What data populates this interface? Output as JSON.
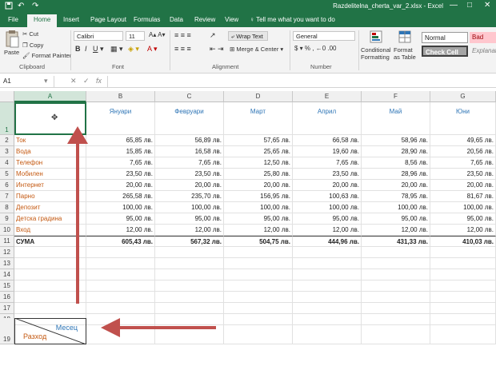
{
  "title_bar": {
    "document_title": "Razdelitelna_cherta_var_2.xlsx - Excel",
    "controls": [
      "—",
      "□",
      "✕"
    ]
  },
  "ribbon_tabs": [
    "File",
    "Home",
    "Insert",
    "Page Layout",
    "Formulas",
    "Data",
    "Review",
    "View"
  ],
  "active_tab": "Home",
  "tell_me": "Tell me what you want to do",
  "ribbon": {
    "clipboard": {
      "paste": "Paste",
      "cut": "Cut",
      "copy": "Copy",
      "format_painter": "Format Painter",
      "label": "Clipboard"
    },
    "font": {
      "name": "Calibri",
      "size": "11",
      "label": "Font"
    },
    "alignment": {
      "wrap_text": "Wrap Text",
      "merge_center": "Merge & Center",
      "label": "Alignment"
    },
    "number": {
      "format": "General",
      "label": "Number"
    },
    "styles": {
      "conditional": "Conditional Formatting",
      "format_table": "Format as Table",
      "normal": "Normal",
      "bad": "Bad",
      "check_cell": "Check Cell",
      "explanatory": "Explanato"
    }
  },
  "formula_bar": {
    "name_box": "A1",
    "fx": "fx",
    "value": ""
  },
  "columns": [
    "A",
    "B",
    "C",
    "D",
    "E",
    "F",
    "G"
  ],
  "header_row": [
    "",
    "Януари",
    "Февруари",
    "Март",
    "Април",
    "Май",
    "Юни"
  ],
  "rows": [
    {
      "n": "2",
      "cells": [
        "Ток",
        "65,85 лв.",
        "56,89 лв.",
        "57,65 лв.",
        "66,58 лв.",
        "58,96 лв.",
        "49,65 лв."
      ]
    },
    {
      "n": "3",
      "cells": [
        "Вода",
        "15,85 лв.",
        "16,58 лв.",
        "25,65 лв.",
        "19,60 лв.",
        "28,90 лв.",
        "20,56 лв."
      ]
    },
    {
      "n": "4",
      "cells": [
        "Телефон",
        "7,65 лв.",
        "7,65 лв.",
        "12,50 лв.",
        "7,65 лв.",
        "8,56 лв.",
        "7,65 лв."
      ]
    },
    {
      "n": "5",
      "cells": [
        "Мобилен",
        "23,50 лв.",
        "23,50 лв.",
        "25,80 лв.",
        "23,50 лв.",
        "28,96 лв.",
        "23,50 лв."
      ]
    },
    {
      "n": "6",
      "cells": [
        "Интернет",
        "20,00 лв.",
        "20,00 лв.",
        "20,00 лв.",
        "20,00 лв.",
        "20,00 лв.",
        "20,00 лв."
      ]
    },
    {
      "n": "7",
      "cells": [
        "Парно",
        "265,58 лв.",
        "235,70 лв.",
        "156,95 лв.",
        "100,63 лв.",
        "78,95 лв.",
        "81,67 лв."
      ]
    },
    {
      "n": "8",
      "cells": [
        "Депозит",
        "100,00 лв.",
        "100,00 лв.",
        "100,00 лв.",
        "100,00 лв.",
        "100,00 лв.",
        "100,00 лв."
      ]
    },
    {
      "n": "9",
      "cells": [
        "Детска градина",
        "95,00 лв.",
        "95,00 лв.",
        "95,00 лв.",
        "95,00 лв.",
        "95,00 лв.",
        "95,00 лв."
      ]
    },
    {
      "n": "10",
      "cells": [
        "Вход",
        "12,00 лв.",
        "12,00 лв.",
        "12,00 лв.",
        "12,00 лв.",
        "12,00 лв.",
        "12,00 лв."
      ]
    },
    {
      "n": "11",
      "cells": [
        "СУМА",
        "605,43 лв.",
        "567,32 лв.",
        "504,75 лв.",
        "444,96 лв.",
        "431,33 лв.",
        "410,03 лв."
      ]
    }
  ],
  "empty_rows": [
    "12",
    "13",
    "14",
    "15",
    "16",
    "17",
    "18"
  ],
  "row_1_label": "1",
  "row_19_label": "19",
  "a19": {
    "top_right": "Месец",
    "bottom_left": "Разход"
  },
  "colors": {
    "excel_green": "#217346",
    "arrow": "#c0504d",
    "label_orange": "#c45911",
    "header_blue": "#2e75b6"
  },
  "icons": [
    "undo-icon",
    "redo-icon",
    "save-icon",
    "paste-icon",
    "cut-icon",
    "copy-icon",
    "format-painter-icon",
    "lightbulb-icon",
    "cursor-move-icon"
  ]
}
